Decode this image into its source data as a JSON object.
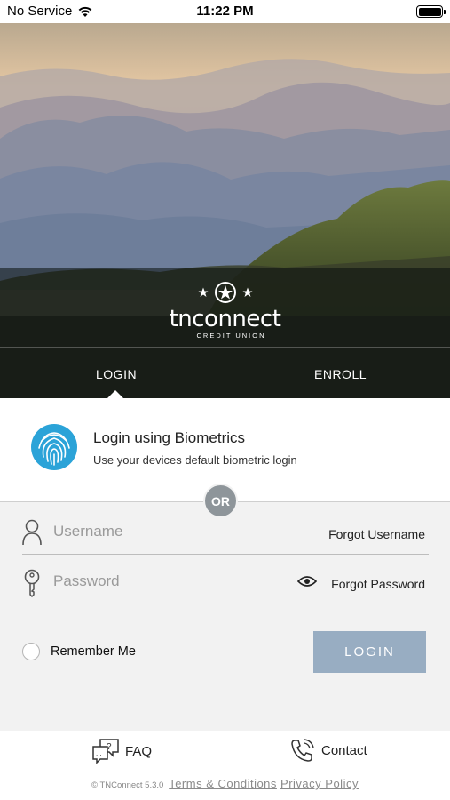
{
  "status_bar": {
    "carrier": "No Service",
    "time": "11:22 PM"
  },
  "brand": {
    "name": "tnconnect",
    "subtitle": "CREDIT UNION"
  },
  "tabs": {
    "login": "LOGIN",
    "enroll": "ENROLL"
  },
  "biometrics": {
    "title": "Login using Biometrics",
    "subtitle": "Use your devices default biometric login"
  },
  "divider": {
    "or": "OR"
  },
  "form": {
    "username_placeholder": "Username",
    "username_value": "",
    "forgot_username": "Forgot Username",
    "password_placeholder": "Password",
    "password_value": "",
    "forgot_password": "Forgot Password",
    "remember_me": "Remember Me",
    "login_button": "LOGIN"
  },
  "footer": {
    "faq": "FAQ",
    "contact": "Contact",
    "version": "© TNConnect 5.3.0",
    "terms": "Terms & Conditions",
    "privacy": "Privacy Policy"
  },
  "colors": {
    "login_button": "#98adc2",
    "or_badge": "#8e959a",
    "fingerprint": "#2ba3d8"
  },
  "icons": [
    "wifi-icon",
    "battery-icon",
    "star-icon",
    "fingerprint-icon",
    "user-icon",
    "key-icon",
    "eye-icon",
    "faq-icon",
    "phone-icon"
  ]
}
